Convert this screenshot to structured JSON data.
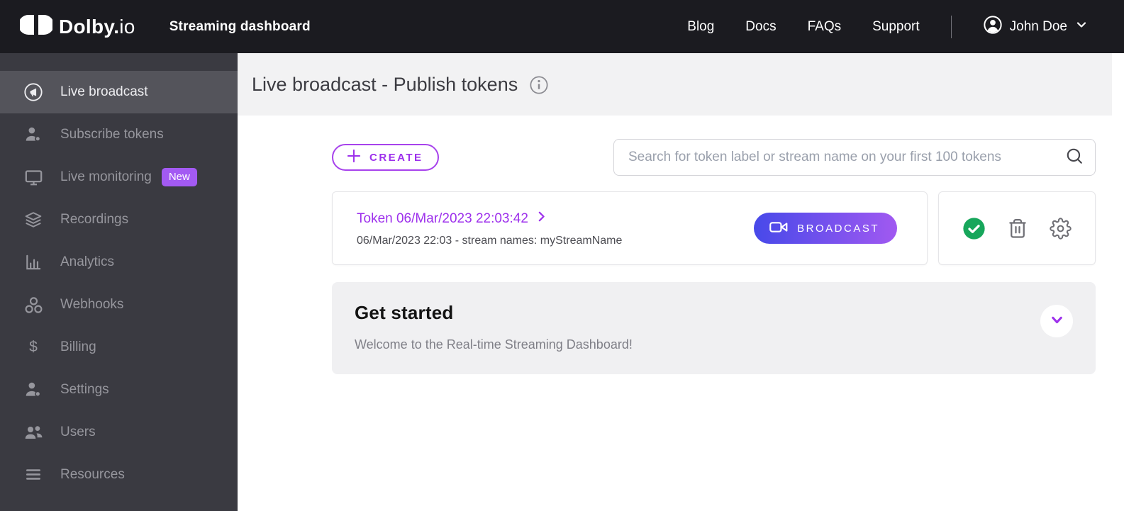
{
  "header": {
    "brand_bold": "Dolby.",
    "brand_light": "io",
    "app_title": "Streaming dashboard",
    "nav": [
      "Blog",
      "Docs",
      "FAQs",
      "Support"
    ],
    "user_name": "John Doe"
  },
  "sidebar": {
    "items": [
      {
        "label": "Live broadcast",
        "icon": "broadcast-icon",
        "active": true
      },
      {
        "label": "Subscribe tokens",
        "icon": "subscriber-icon"
      },
      {
        "label": "Live monitoring",
        "icon": "monitor-icon",
        "badge": "New"
      },
      {
        "label": "Recordings",
        "icon": "layers-icon"
      },
      {
        "label": "Analytics",
        "icon": "bar-chart-icon"
      },
      {
        "label": "Webhooks",
        "icon": "webhook-icon"
      },
      {
        "label": "Billing",
        "icon": "dollar-icon",
        "dollar_glyph": "$"
      },
      {
        "label": "Settings",
        "icon": "user-gear-icon"
      },
      {
        "label": "Users",
        "icon": "users-icon"
      },
      {
        "label": "Resources",
        "icon": "list-icon"
      }
    ]
  },
  "main": {
    "page_title": "Live broadcast - Publish tokens",
    "toolbar": {
      "create_label": "CREATE",
      "search_placeholder": "Search for token label or stream name on your first 100 tokens"
    },
    "token": {
      "title": "Token 06/Mar/2023 22:03:42",
      "subtitle": "06/Mar/2023 22:03 - stream names: myStreamName",
      "broadcast_label": "BROADCAST"
    },
    "get_started": {
      "title": "Get started",
      "subtitle": "Welcome to the Real-time Streaming Dashboard!"
    }
  },
  "colors": {
    "accent_purple": "#9D30EC",
    "badge_purple": "#A35AF3",
    "broadcast_gradient_start": "#4749E9",
    "broadcast_gradient_end": "#A159F1",
    "status_green": "#17A65B",
    "header_bg": "#1B1B20",
    "sidebar_bg": "#3A3A41",
    "sidebar_active_bg": "#54545B",
    "title_band_bg": "#F2F2F3",
    "panel_bg": "#F0F0F2"
  }
}
